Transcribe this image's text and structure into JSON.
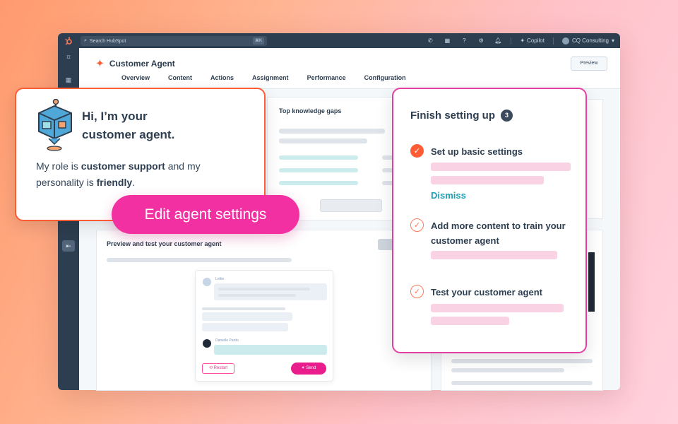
{
  "topbar": {
    "search_placeholder": "Search HubSpot",
    "search_shortcut": "⌘K",
    "copilot_label": "Copilot",
    "account_name": "CQ Consulting"
  },
  "header": {
    "title": "Customer Agent",
    "tabs": [
      "Overview",
      "Content",
      "Actions",
      "Assignment",
      "Performance",
      "Configuration"
    ],
    "preview_label": "Preview"
  },
  "knowledge": {
    "title": "Top knowledge gaps"
  },
  "preview_panel": {
    "title": "Preview and test your customer agent"
  },
  "chat": {
    "agent_name": "Lottie",
    "user_name": "Danielle Pardo",
    "restart_label": "Restart",
    "send_label": "Send"
  },
  "intro": {
    "greeting_line1": "Hi, I’m your",
    "greeting_line2": "customer agent.",
    "desc_pre": "My role is ",
    "role": "customer support",
    "desc_mid": " and my personality is ",
    "personality": "friendly",
    "desc_end": "."
  },
  "edit_button": "Edit agent settings",
  "setup": {
    "title": "Finish setting up",
    "count": "3",
    "steps": [
      {
        "label": "Set up basic settings",
        "done": true
      },
      {
        "label": "Add more content to train your customer agent",
        "done": false
      },
      {
        "label": "Test your customer agent",
        "done": false
      }
    ],
    "dismiss_label": "Dismiss"
  },
  "colors": {
    "accent_pink": "#f230a1",
    "accent_orange": "#ff5c35",
    "teal": "#1e9fb4",
    "nav_dark": "#2d3e50"
  }
}
